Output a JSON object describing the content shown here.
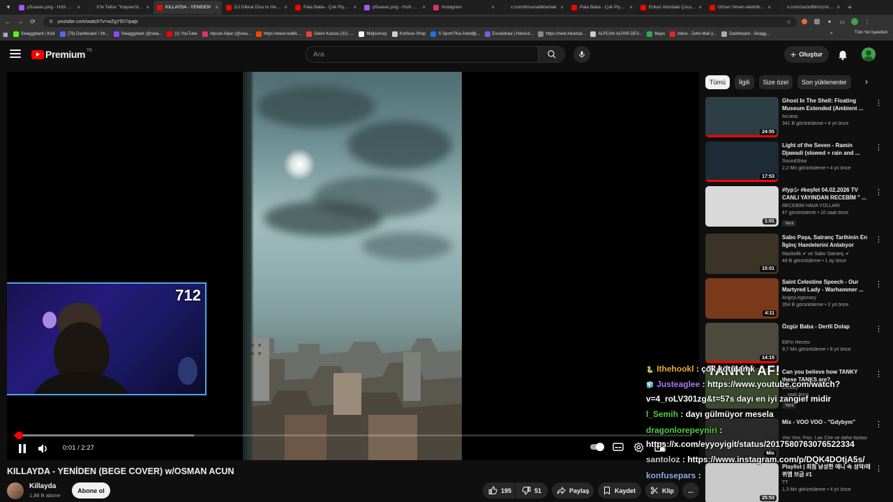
{
  "browser": {
    "tabs": [
      {
        "title": "p5saxec.png - Hızlı Resim",
        "color": "#a855f7",
        "active": false
      },
      {
        "title": "X'te Talha: \"Kayseri'de...",
        "color": "#222222",
        "active": false
      },
      {
        "title": "KILLAYDA - YENİDEN",
        "color": "#ff0000",
        "active": true
      },
      {
        "title": "DJ Dikkat Diss to Heqrim",
        "color": "#ff0000",
        "active": false
      },
      {
        "title": "Pala Baba - Çok Pişman",
        "color": "#ff0000",
        "active": false
      },
      {
        "title": "p5saxec.png - Hızlı Resim",
        "color": "#a855f7",
        "active": false
      },
      {
        "title": "Instagram",
        "color": "#e1306c",
        "active": false
      },
      {
        "title": "x.com/bosunaitiklamak",
        "color": "#222222",
        "active": false
      },
      {
        "title": "Pala Baba - Çok Pişman",
        "color": "#ff0000",
        "active": false
      },
      {
        "title": "Erikez Altındaki Çocuğa",
        "color": "#ff0000",
        "active": false
      },
      {
        "title": "Orhan Yenen elektrik...",
        "color": "#ff0000",
        "active": false
      },
      {
        "title": "x.com/zackdfilms1/status",
        "color": "#222222",
        "active": false
      }
    ],
    "new_tab": "+",
    "url": "youtube.com/watch?v=wZgYEt7rpajs",
    "bookmarks": [
      {
        "label": "Swaggybark | Kick",
        "color": "#53fc18"
      },
      {
        "label": "(79) Dashboard / Str...",
        "color": "#5865f2"
      },
      {
        "label": "Swaggybark (@swa...",
        "color": "#9146ff"
      },
      {
        "label": "(2) YouTube",
        "color": "#ff0000"
      },
      {
        "label": "Alpcan Alpar (@swa...",
        "color": "#e1306c"
      },
      {
        "label": "https://www.reddit....",
        "color": "#ff4500"
      },
      {
        "label": "Gelen Kutusu (31) -...",
        "color": "#ea4335"
      },
      {
        "label": "Midjourney",
        "color": "#ffffff"
      },
      {
        "label": "Konfuse Shop",
        "color": "#cccccc"
      },
      {
        "label": "S Sport Plus-İstediği...",
        "color": "#1a73e8"
      },
      {
        "label": "Excalidraw | Hand-d...",
        "color": "#6965db"
      },
      {
        "label": "https://next.inkamat...",
        "color": "#888888"
      },
      {
        "label": "ALPCAN ALPAR DEV...",
        "color": "#cccccc"
      },
      {
        "label": "Maps",
        "color": "#34a853"
      },
      {
        "label": "Inbox - Zoho Mail (i...",
        "color": "#e42527"
      },
      {
        "label": "Dashboard - Swagg...",
        "color": "#aaaaaa"
      }
    ],
    "bookmarks_more": "»",
    "all_bookmarks": "Tüm Yer İşaretleri"
  },
  "header": {
    "logo_text": "Premium",
    "logo_region": "TR",
    "search_placeholder": "Ara",
    "create_label": "Oluştur"
  },
  "player": {
    "current_time": "0:01",
    "duration": "2:27",
    "time_display": "0:01 / 2:27",
    "played_fraction": 0.0068,
    "buffered_fraction": 0.265,
    "webcam_counter": "712",
    "overlay_text": "TANKY AF!"
  },
  "video": {
    "title": "KILLAYDA - YENİDEN (BEGE COVER) w/OSMAN ACUN",
    "channel": "Killayda",
    "subscribers": "1,88 B abone",
    "subscribe_label": "Abone ol",
    "likes": "195",
    "dislikes": "51",
    "share_label": "Paylaş",
    "save_label": "Kaydet",
    "clip_label": "Klip",
    "more_label": "..."
  },
  "chips": [
    "Tümü",
    "İlgili",
    "Size özel",
    "Son yüklenenler"
  ],
  "recommendations": [
    {
      "title": "Ghost In The Shell: Floating Museum Extended (Ambient ...",
      "channel": "Arcana",
      "meta": "341 B görüntüleme • 4 yıl önce",
      "duration": "24:55",
      "badge": "",
      "thumb": "#2d3f44",
      "progress_fraction": 1.0
    },
    {
      "title": "Light of the Seven - Ramin Djawadi (slowed + rain and ...",
      "channel": "SoundSlow",
      "meta": "2,2 Mn görüntüleme • 4 yıl önce",
      "duration": "17:53",
      "badge": "",
      "thumb": "#1c2b36",
      "progress_fraction": 1.0
    },
    {
      "title": "#fypシ #keşfet 04.02.2026 TV CANLI YAYINDAN RECEBİM \" ...",
      "channel": "RECEBİM HAVA YOLLARI",
      "meta": "47 görüntüleme • 10 saat önce",
      "duration": "1:01",
      "badge": "Yeni",
      "thumb": "#d9d9d9",
      "progress_fraction": 0
    },
    {
      "title": "Sabo Paşa, Satranç Tarihinin En İlginç Hamlelerini Anlatıyor",
      "channel": "Mackolik ✔ ve Sabo Satranç ✔",
      "meta": "48 B görüntüleme • 1 ay önce",
      "duration": "15:01",
      "badge": "",
      "thumb": "#3b3326",
      "progress_fraction": 0
    },
    {
      "title": "Saint Celestine Speech - Our Martyred Lady - Warhammer ...",
      "channel": "AngryLegionary",
      "meta": "354 B görüntüleme • 2 yıl önce",
      "duration": "4:11",
      "badge": "",
      "thumb": "#7a3a1a",
      "progress_fraction": 0
    },
    {
      "title": "Özgür Baba - Dertli Dolap",
      "channel": "Elif'in Hecesi",
      "meta": "9,7 Mn görüntüleme • 8 yıl önce",
      "duration": "14:15",
      "badge": "",
      "thumb": "#4b4a3c",
      "progress_fraction": 1.0
    },
    {
      "title": "Can you believe how TANKY these TANKS are?",
      "channel": "Grubby",
      "meta": "... saat önce",
      "duration": "",
      "badge": "Yeni",
      "thumb": "#3a4a2e",
      "progress_fraction": 0
    },
    {
      "title": "Mix - VOO VOO - \"Gdybym\"",
      "channel": "Voo Voo, Fisz, Lao Che ve daha fazlası",
      "meta": "",
      "duration": "Mix",
      "badge": "",
      "thumb": "#2a2a2a",
      "progress_fraction": 0
    },
    {
      "title": "Playlist | 최첨 남성한 애니 속 성악/레퀴엠 브금 #1",
      "channel": "TT",
      "meta": "1,3 Mn görüntüleme • 4 yıl önce",
      "duration": "25:53",
      "badge": "",
      "thumb": "#c9c9c9",
      "progress_fraction": 0
    }
  ],
  "chat": [
    {
      "user": "Ithehookl",
      "text": ": çok kötü amk",
      "badge": "🐍"
    },
    {
      "user": "Justeaglee",
      "text": ": https://www.youtube.com/watch?",
      "badge": "🧊"
    },
    {
      "user": "",
      "text": "v=4_roLV301zg&t=57s dayı en iyi zangief midir",
      "badge": ""
    },
    {
      "user": "l_Semih",
      "text": ": dayı gülmüyor mesela",
      "badge": ""
    },
    {
      "user": "dragonlorepeyniri",
      "text": ":",
      "badge": ""
    },
    {
      "user": "",
      "text": "https://x.com/eyyoyigit/status/2017580763076522334",
      "badge": ""
    },
    {
      "user": "santoloz",
      "text": ": https://www.instagram.com/p/DQK4DOtjA5s/",
      "badge": ""
    },
    {
      "user": "konfusepars",
      "text": ":",
      "badge": ""
    }
  ]
}
